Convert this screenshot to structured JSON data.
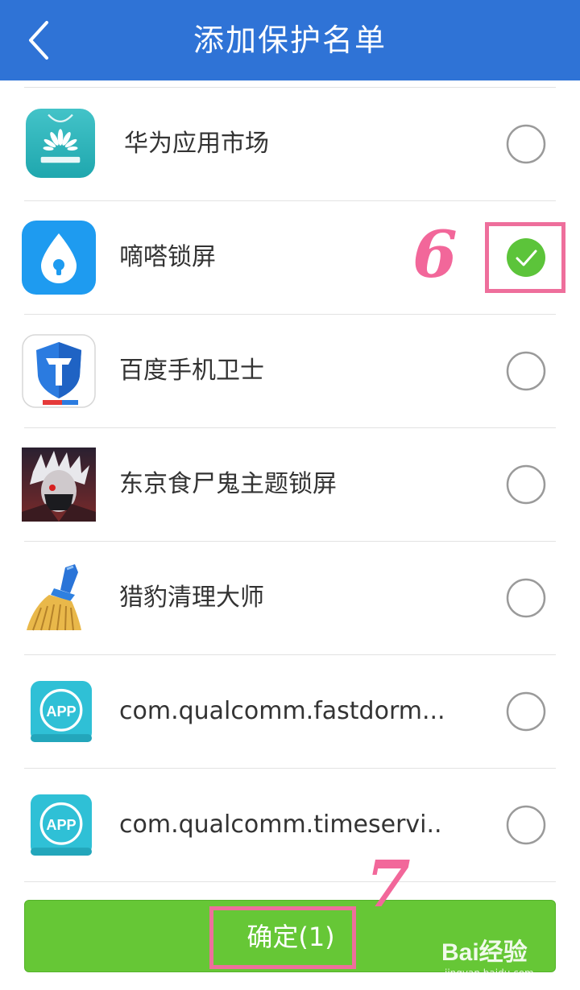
{
  "header": {
    "title": "添加保护名单",
    "back_icon": "chevron-left-icon",
    "background": "#2f73d6"
  },
  "apps": [
    {
      "name": "华为应用市场",
      "icon": "huawei-appgallery-icon",
      "checked": false
    },
    {
      "name": "嘀嗒锁屏",
      "icon": "dida-lockscreen-icon",
      "checked": true
    },
    {
      "name": "百度手机卫士",
      "icon": "baidu-guard-icon",
      "checked": false
    },
    {
      "name": "东京食尸鬼主题锁屏",
      "icon": "tokyo-ghoul-theme-icon",
      "checked": false
    },
    {
      "name": "猎豹清理大师",
      "icon": "broom-icon",
      "checked": false
    },
    {
      "name": "com.qualcomm.fastdorm...",
      "icon": "app-generic-icon",
      "checked": false
    },
    {
      "name": "com.qualcomm.timeservi..",
      "icon": "app-generic-icon",
      "checked": false
    }
  ],
  "annotations": {
    "step6": "6",
    "step7": "7",
    "color": "#ee6f9c"
  },
  "confirm_button": {
    "label": "确定(1)",
    "color": "#66c736"
  },
  "watermark": {
    "brand": "Bai经验",
    "url": "jingyan.baidu.com"
  },
  "colors": {
    "check_green": "#5cc43a",
    "radio_border": "#9a9a9a"
  }
}
